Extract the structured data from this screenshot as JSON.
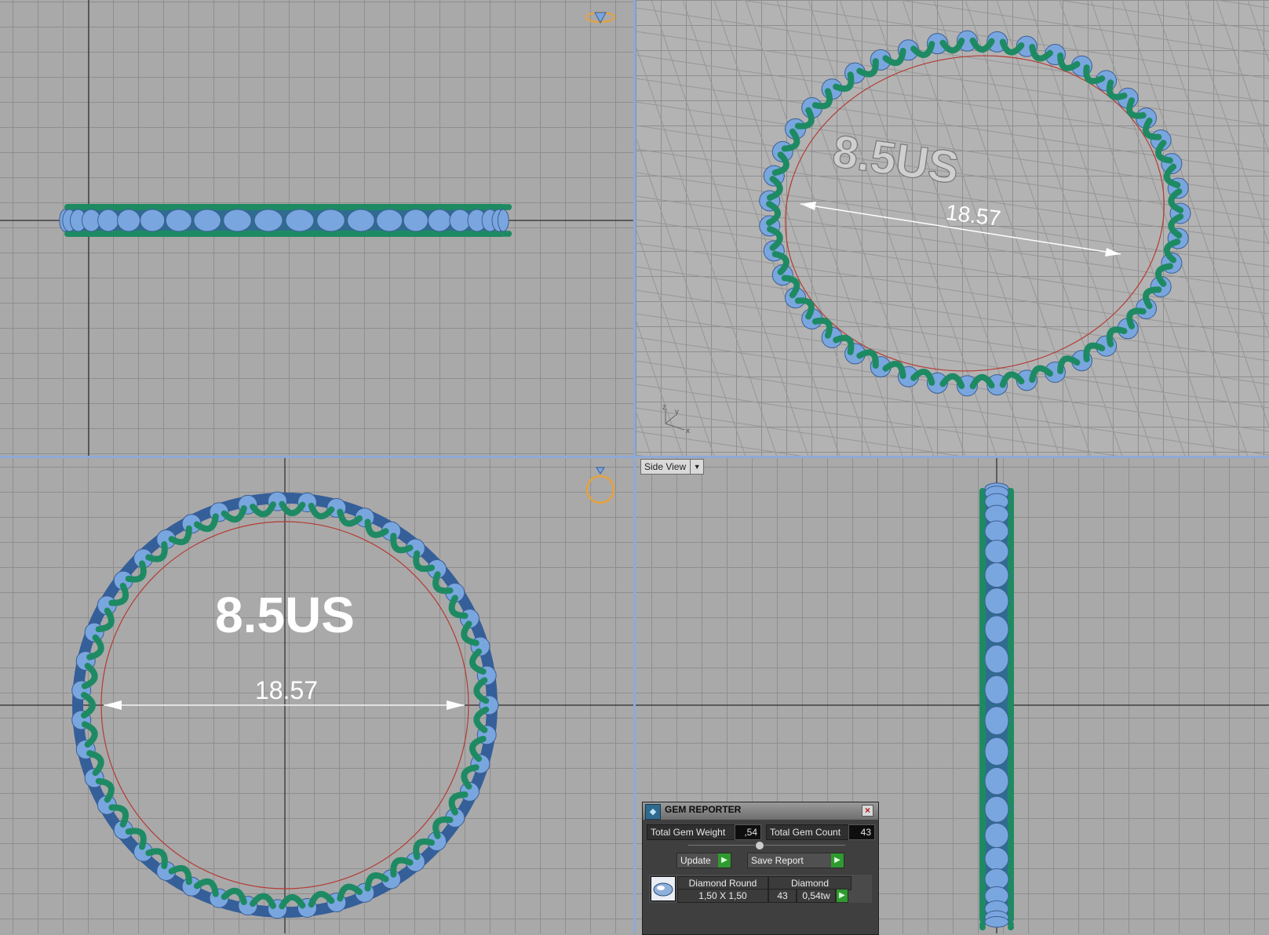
{
  "viewports": {
    "top_left": {
      "name": "front"
    },
    "top_right": {
      "name": "perspective",
      "size_text": "8.5US",
      "dimension": "18.57",
      "axis_labels": [
        "z",
        "y",
        "x"
      ]
    },
    "bottom_left": {
      "name": "top",
      "size_text": "8.5US",
      "dimension": "18.57"
    },
    "bottom_right": {
      "name": "side",
      "label": "Side View"
    }
  },
  "gem_reporter": {
    "title": "GEM REPORTER",
    "total_weight_label": "Total Gem Weight",
    "total_weight_value": ",54",
    "total_count_label": "Total Gem Count",
    "total_count_value": "43",
    "update_button": "Update",
    "save_report_button": "Save Report",
    "gems": [
      {
        "name": "Diamond Round",
        "size": "1,50 X 1,50",
        "material": "Diamond",
        "count": "43",
        "weight": "0,54tw"
      }
    ]
  },
  "colors": {
    "prong": "#1e8a63",
    "gem": "#7aa6df",
    "grid_bg": "#a9a9a9",
    "divider": "#8fa9d6",
    "gizmo": "#e8a23a"
  },
  "icons": [
    "ring-gizmo-icon",
    "diamond-gizmo-icon",
    "axis-icon",
    "gem-reporter-logo-icon",
    "close-icon",
    "play-arrow-icon",
    "dropdown-arrow-icon",
    "diamond-thumbnail-icon"
  ]
}
